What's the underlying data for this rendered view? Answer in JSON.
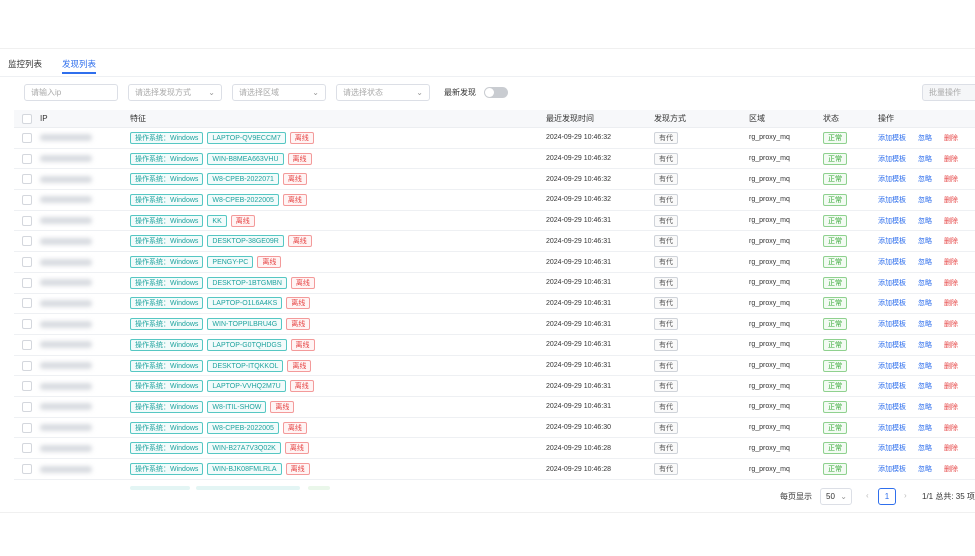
{
  "tabs": [
    {
      "label": "监控列表",
      "active": false
    },
    {
      "label": "发现列表",
      "active": true
    }
  ],
  "filters": {
    "ip_placeholder": "请输入ip",
    "method_placeholder": "请选择发现方式",
    "region_placeholder": "请选择区域",
    "status_placeholder": "请选择状态",
    "latest_label": "最新发现",
    "latest_on": false,
    "batch_label": "批量操作"
  },
  "columns": [
    "IP",
    "特征",
    "最近发现时间",
    "发现方式",
    "区域",
    "状态",
    "操作"
  ],
  "rows": [
    {
      "os": "操作系统：Windows",
      "host": "LAPTOP-QV9ECCM7",
      "flag": "离线",
      "time": "2024-09-29 10:46:32",
      "method": "有代",
      "region": "rg_proxy_mq",
      "status": "正常"
    },
    {
      "os": "操作系统：Windows",
      "host": "WIN-B8MEA663VHU",
      "flag": "离线",
      "time": "2024-09-29 10:46:32",
      "method": "有代",
      "region": "rg_proxy_mq",
      "status": "正常"
    },
    {
      "os": "操作系统：Windows",
      "host": "W8-CPEB-2022071",
      "flag": "离线",
      "time": "2024-09-29 10:46:32",
      "method": "有代",
      "region": "rg_proxy_mq",
      "status": "正常"
    },
    {
      "os": "操作系统：Windows",
      "host": "W8-CPEB-2022005",
      "flag": "离线",
      "time": "2024-09-29 10:46:32",
      "method": "有代",
      "region": "rg_proxy_mq",
      "status": "正常"
    },
    {
      "os": "操作系统：Windows",
      "host": "KK",
      "flag": "离线",
      "time": "2024-09-29 10:46:31",
      "method": "有代",
      "region": "rg_proxy_mq",
      "status": "正常"
    },
    {
      "os": "操作系统：Windows",
      "host": "DESKTOP-38GE09R",
      "flag": "离线",
      "time": "2024-09-29 10:46:31",
      "method": "有代",
      "region": "rg_proxy_mq",
      "status": "正常"
    },
    {
      "os": "操作系统：Windows",
      "host": "PENGY-PC",
      "flag": "离线",
      "time": "2024-09-29 10:46:31",
      "method": "有代",
      "region": "rg_proxy_mq",
      "status": "正常"
    },
    {
      "os": "操作系统：Windows",
      "host": "DESKTOP-1BTGMBN",
      "flag": "离线",
      "time": "2024-09-29 10:46:31",
      "method": "有代",
      "region": "rg_proxy_mq",
      "status": "正常"
    },
    {
      "os": "操作系统：Windows",
      "host": "LAPTOP-O1L6A4KS",
      "flag": "离线",
      "time": "2024-09-29 10:46:31",
      "method": "有代",
      "region": "rg_proxy_mq",
      "status": "正常"
    },
    {
      "os": "操作系统：Windows",
      "host": "WIN-TOPPILBRU4G",
      "flag": "离线",
      "time": "2024-09-29 10:46:31",
      "method": "有代",
      "region": "rg_proxy_mq",
      "status": "正常"
    },
    {
      "os": "操作系统：Windows",
      "host": "LAPTOP-G0TQHDGS",
      "flag": "离线",
      "time": "2024-09-29 10:46:31",
      "method": "有代",
      "region": "rg_proxy_mq",
      "status": "正常"
    },
    {
      "os": "操作系统：Windows",
      "host": "DESKTOP-ITQKKOL",
      "flag": "离线",
      "time": "2024-09-29 10:46:31",
      "method": "有代",
      "region": "rg_proxy_mq",
      "status": "正常"
    },
    {
      "os": "操作系统：Windows",
      "host": "LAPTOP-VVHQ2M7U",
      "flag": "离线",
      "time": "2024-09-29 10:46:31",
      "method": "有代",
      "region": "rg_proxy_mq",
      "status": "正常"
    },
    {
      "os": "操作系统：Windows",
      "host": "W8-ITIL-SHOW",
      "flag": "离线",
      "time": "2024-09-29 10:46:31",
      "method": "有代",
      "region": "rg_proxy_mq",
      "status": "正常"
    },
    {
      "os": "操作系统：Windows",
      "host": "W8-CPEB-2022005",
      "flag": "离线",
      "time": "2024-09-29 10:46:30",
      "method": "有代",
      "region": "rg_proxy_mq",
      "status": "正常"
    },
    {
      "os": "操作系统：Windows",
      "host": "WIN-B27A7V3Q02K",
      "flag": "离线",
      "time": "2024-09-29 10:46:28",
      "method": "有代",
      "region": "rg_proxy_mq",
      "status": "正常"
    },
    {
      "os": "操作系统：Windows",
      "host": "WIN-BJK08FMLRLA",
      "flag": "离线",
      "time": "2024-09-29 10:46:28",
      "method": "有代",
      "region": "rg_proxy_mq",
      "status": "正常"
    }
  ],
  "actions": {
    "add_template": "添加模板",
    "ignore": "忽略",
    "delete": "删除"
  },
  "pagination": {
    "page_size_label": "每页显示",
    "page_size": "50",
    "current_page": "1",
    "summary": "1/1 总共: 35 项"
  },
  "colors": {
    "accent": "#2f6fed",
    "teal": "#1fa39e",
    "red": "#e64545",
    "green": "#34a734"
  },
  "icons": {
    "dropdown": "chevron-down-icon",
    "prev": "chevron-left-icon",
    "next": "chevron-right-icon"
  }
}
